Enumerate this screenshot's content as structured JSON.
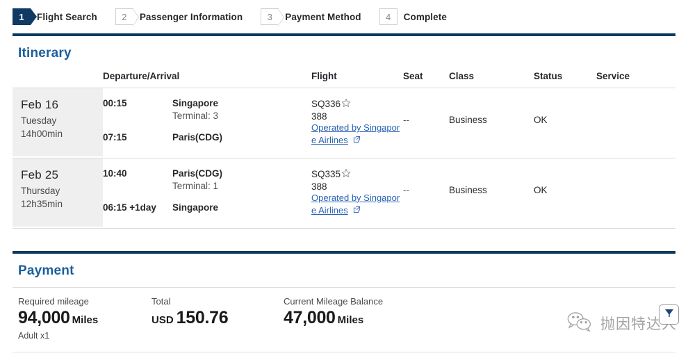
{
  "steps": [
    {
      "number": "1",
      "label": "Flight Search",
      "state": "active"
    },
    {
      "number": "2",
      "label": "Passenger Information",
      "state": "idle"
    },
    {
      "number": "3",
      "label": "Payment Method",
      "state": "idle"
    },
    {
      "number": "4",
      "label": "Complete",
      "state": "idle-flat"
    }
  ],
  "itinerary": {
    "title": "Itinerary",
    "headers": {
      "date": "",
      "departure_arrival": "Departure/Arrival",
      "flight": "Flight",
      "seat": "Seat",
      "class": "Class",
      "status": "Status",
      "service": "Service"
    },
    "rows": [
      {
        "date": "Feb 16",
        "weekday": "Tuesday",
        "duration": "14h00min",
        "depart_time": "00:15",
        "depart_place": "Singapore",
        "depart_terminal": "Terminal: 3",
        "arrive_time": "07:15",
        "arrive_place": "Paris(CDG)",
        "flight_number": "SQ336",
        "flight_icon": "star-alliance-icon",
        "equipment": "388",
        "operated_by": "Operated by Singapore Airlines",
        "seat": "--",
        "class": "Business",
        "status": "OK",
        "service": ""
      },
      {
        "date": "Feb 25",
        "weekday": "Thursday",
        "duration": "12h35min",
        "depart_time": "10:40",
        "depart_place": "Paris(CDG)",
        "depart_terminal": "Terminal: 1",
        "arrive_time": "06:15 +1day",
        "arrive_place": "Singapore",
        "flight_number": "SQ335",
        "flight_icon": "star-alliance-icon",
        "equipment": "388",
        "operated_by": "Operated by Singapore Airlines",
        "seat": "--",
        "class": "Business",
        "status": "OK",
        "service": ""
      }
    ]
  },
  "payment": {
    "title": "Payment",
    "required_mileage": {
      "label": "Required mileage",
      "value": "94,000",
      "unit": "Miles",
      "sub": "Adult x1"
    },
    "total": {
      "label": "Total",
      "currency": "USD",
      "value": "150.76"
    },
    "balance": {
      "label": "Current Mileage Balance",
      "value": "47,000",
      "unit": "Miles"
    }
  },
  "watermark": {
    "text": "抛因特达人"
  },
  "colors": {
    "navy_rule": "#0d3b5f",
    "step_active": "#103a63",
    "section_title": "#1b5e9c",
    "link": "#2a63b5",
    "date_cell_bg": "#efefef"
  }
}
